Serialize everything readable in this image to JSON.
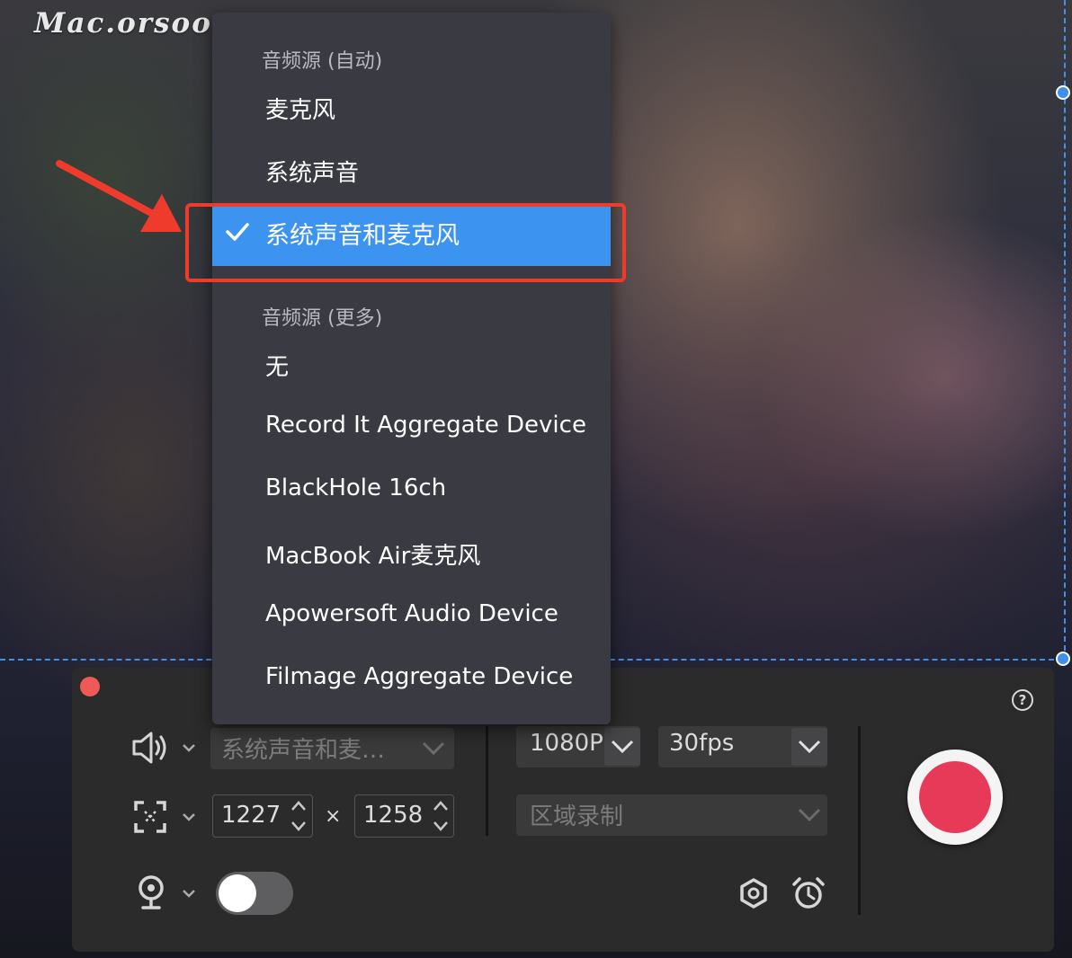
{
  "watermark": "Mac.orsoon.com",
  "menu": {
    "header_auto": "音频源 (自动)",
    "auto_items": [
      "麦克风",
      "系统声音"
    ],
    "selected_item": "系统声音和麦克风",
    "header_more": "音频源 (更多)",
    "more_items": [
      "无",
      "Record It Aggregate Device",
      "BlackHole 16ch",
      "MacBook Air麦克风",
      "Apowersoft Audio Device",
      "Filmage Aggregate Device"
    ]
  },
  "panel": {
    "help_label": "?",
    "audio_source_value": "系统声音和麦…",
    "width_value": "1227",
    "times_sign": "×",
    "height_value": "1258",
    "resolution_value": "1080P",
    "fps_value": "30fps",
    "mode_value": "区域录制",
    "webcam_enabled": false
  },
  "colors": {
    "accent": "#3d94f0",
    "record": "#e63a58",
    "highlight_box": "#ee3b2c",
    "close": "#ee5a55"
  },
  "icons": [
    "speaker-icon",
    "region-select-icon",
    "webcam-icon",
    "gear-icon",
    "alarm-clock-icon",
    "checkmark-icon",
    "chevron-down-icon",
    "help-icon",
    "stepper-icon"
  ]
}
